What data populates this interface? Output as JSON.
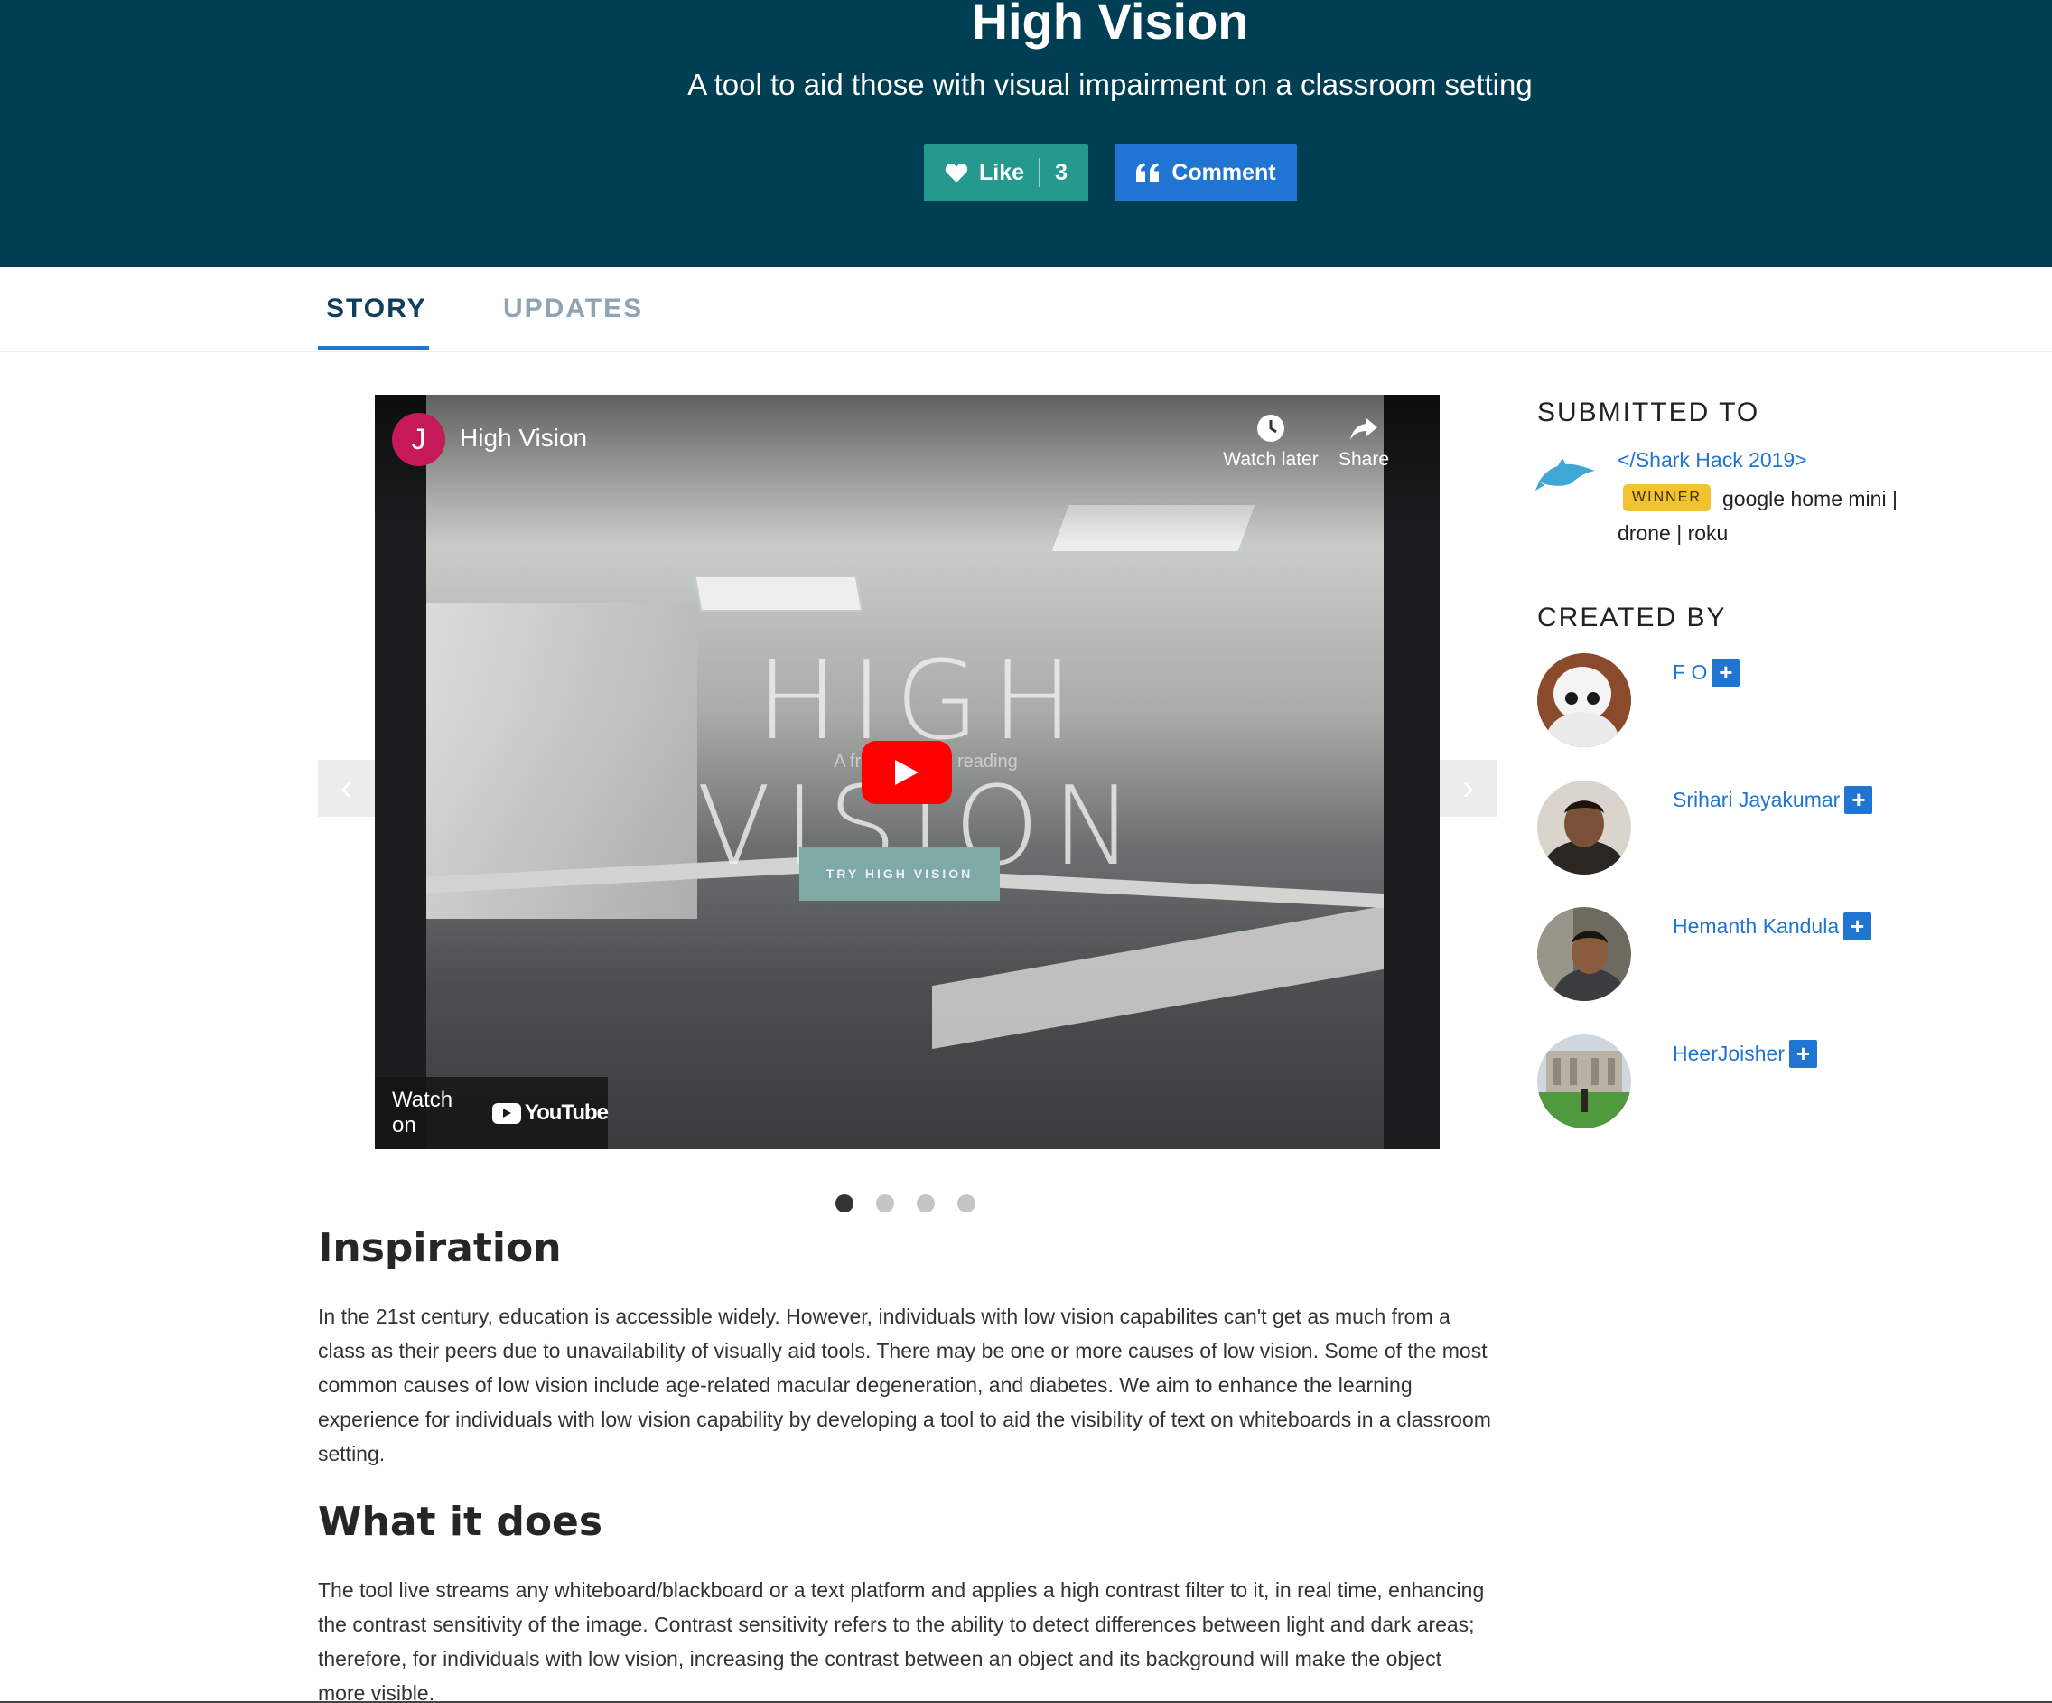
{
  "header": {
    "title": "High Vision",
    "tagline": "A tool to aid those with visual impairment on a classroom setting",
    "like_label": "Like",
    "like_count": "3",
    "comment_label": "Comment"
  },
  "tabs": [
    {
      "label": "STORY",
      "active": true
    },
    {
      "label": "UPDATES",
      "active": false
    }
  ],
  "video": {
    "channel_initial": "J",
    "title": "High Vision",
    "watch_later": "Watch later",
    "share": "Share",
    "frame_heading": "HIGH VISION",
    "frame_subtext": "A free, resp          for reading",
    "frame_button": "TRY HIGH VISION",
    "watch_on": "Watch on",
    "youtube": "YouTube"
  },
  "carousel": {
    "slide_count": 4,
    "active_index": 0
  },
  "story": {
    "sections": [
      {
        "heading": "Inspiration",
        "body": "In the 21st century, education is accessible widely. However, individuals with low vision capabilites can't get as much from a class as their peers due to unavailability of visually aid tools. There may be one or more causes of low vision. Some of the most common causes of low vision include age-related macular degeneration, and diabetes. We aim to enhance the learning experience for individuals with low vision capability by developing a tool to aid the visibility of text on whiteboards in a classroom setting."
      },
      {
        "heading": "What it does",
        "body": "The tool live streams any whiteboard/blackboard or a text platform and applies a high contrast filter to it, in real time, enhancing the contrast sensitivity of the image. Contrast sensitivity refers to the ability to detect differences between light and dark areas; therefore, for individuals with low vision, increasing the contrast between an object and its background will make the object more visible."
      }
    ]
  },
  "sidebar": {
    "submitted_heading": "SUBMITTED TO",
    "hackathon": "</Shark Hack 2019>",
    "winner_badge": "WINNER",
    "prizes": "google home mini | drone | roku",
    "created_heading": "CREATED BY",
    "members": [
      {
        "name": "F O"
      },
      {
        "name": "Srihari Jayakumar"
      },
      {
        "name": "Hemanth Kandula"
      },
      {
        "name": "HeerJoisher"
      }
    ]
  },
  "colors": {
    "header_bg": "#003e54",
    "like_button": "#26998f",
    "comment_button": "#1f75d1",
    "link": "#1f75d1",
    "winner_badge": "#f2c230"
  }
}
